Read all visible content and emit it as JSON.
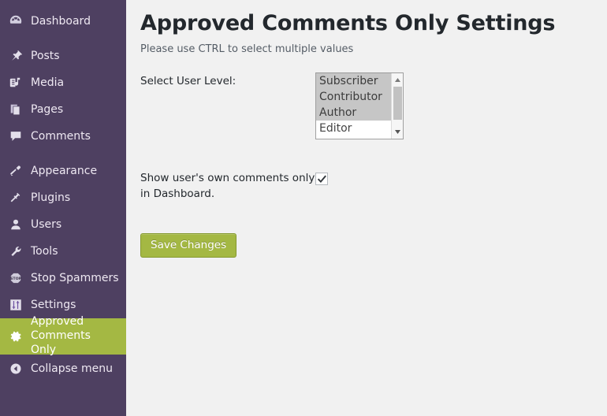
{
  "colors": {
    "sidebar_bg": "#4e4061",
    "accent_green": "#a4b843",
    "button_border": "#85992f",
    "content_bg": "#f1f1f1",
    "heading_text": "#23282d",
    "checkmark": "#32373c"
  },
  "sidebar": {
    "items": [
      {
        "label": "Dashboard",
        "icon": "dashboard-gauge-icon",
        "active": false,
        "gap_after": true
      },
      {
        "label": "Posts",
        "icon": "pin-icon",
        "active": false,
        "gap_after": false
      },
      {
        "label": "Media",
        "icon": "media-icon",
        "active": false,
        "gap_after": false
      },
      {
        "label": "Pages",
        "icon": "pages-icon",
        "active": false,
        "gap_after": false
      },
      {
        "label": "Comments",
        "icon": "comment-bubble-icon",
        "active": false,
        "gap_after": true
      },
      {
        "label": "Appearance",
        "icon": "paintbrush-icon",
        "active": false,
        "gap_after": false
      },
      {
        "label": "Plugins",
        "icon": "plug-icon",
        "active": false,
        "gap_after": false
      },
      {
        "label": "Users",
        "icon": "user-icon",
        "active": false,
        "gap_after": false
      },
      {
        "label": "Tools",
        "icon": "wrench-icon",
        "active": false,
        "gap_after": false
      },
      {
        "label": "Stop Spammers",
        "icon": "stop-sign-icon",
        "active": false,
        "gap_after": false
      },
      {
        "label": "Settings",
        "icon": "sliders-icon",
        "active": false,
        "gap_after": false
      },
      {
        "label": "Approved Comments Only",
        "icon": "gear-icon",
        "active": true,
        "gap_after": false
      }
    ],
    "collapse": {
      "label": "Collapse menu",
      "icon": "collapse-left-arrow-icon"
    }
  },
  "main": {
    "title": "Approved Comments Only Settings",
    "subtitle": "Please use CTRL to select multiple values",
    "user_level": {
      "label": "Select User Level:",
      "options": [
        {
          "label": "Subscriber",
          "selected": true
        },
        {
          "label": "Contributor",
          "selected": true
        },
        {
          "label": "Author",
          "selected": true
        },
        {
          "label": "Editor",
          "selected": false
        }
      ]
    },
    "own_comments": {
      "label": "Show user's own comments only in Dashboard.",
      "checked": true
    },
    "save_label": "Save Changes"
  }
}
